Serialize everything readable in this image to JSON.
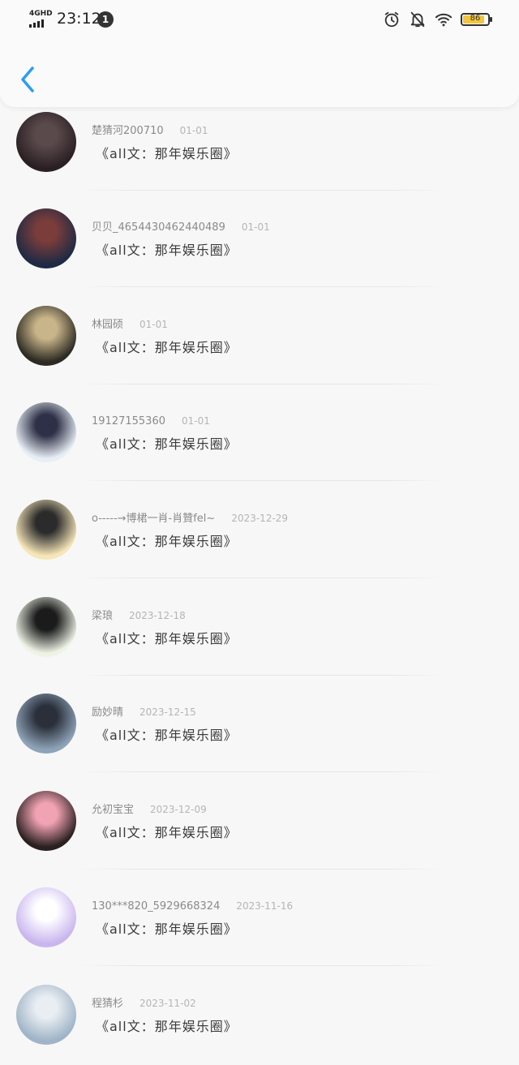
{
  "status_bar": {
    "network": "4GHD",
    "time": "23:12",
    "notification_count": "1",
    "battery": "86",
    "icons": [
      "alarm-icon",
      "bell-muted-icon",
      "wifi-icon",
      "battery-icon"
    ]
  },
  "header": {
    "back_icon": "chevron-left-icon",
    "accent": "#2a9df4"
  },
  "items": [
    {
      "user": "楚猜河200710",
      "date": "01-01",
      "content": "《all文：那年娱乐圈》",
      "avatar_colors": [
        "#2a2024",
        "#5b4a4c"
      ]
    },
    {
      "user": "贝贝_4654430462440489",
      "date": "01-01",
      "content": "《all文：那年娱乐圈》",
      "avatar_colors": [
        "#1f2a44",
        "#7a3d3a"
      ]
    },
    {
      "user": "林园硕",
      "date": "01-01",
      "content": "《all文：那年娱乐圈》",
      "avatar_colors": [
        "#2c2a22",
        "#c9b58a"
      ]
    },
    {
      "user": "19127155360",
      "date": "01-01",
      "content": "《all文：那年娱乐圈》",
      "avatar_colors": [
        "#e8eef5",
        "#2d3046"
      ]
    },
    {
      "user": "o-----→博桾一肖-肖贊fel~",
      "date": "2023-12-29",
      "content": "《all文：那年娱乐圈》",
      "avatar_colors": [
        "#f6e6b8",
        "#2b2b2b"
      ]
    },
    {
      "user": "梁琅",
      "date": "2023-12-18",
      "content": "《all文：那年娱乐圈》",
      "avatar_colors": [
        "#eef3e6",
        "#1b1b1b"
      ]
    },
    {
      "user": "励妙晴",
      "date": "2023-12-15",
      "content": "《all文：那年娱乐圈》",
      "avatar_colors": [
        "#8ea3b8",
        "#2a2f3a"
      ]
    },
    {
      "user": "允初宝宝",
      "date": "2023-12-09",
      "content": "《all文：那年娱乐圈》",
      "avatar_colors": [
        "#2a2020",
        "#f2a3b3"
      ]
    },
    {
      "user": "130***820_5929668324",
      "date": "2023-11-16",
      "content": "《all文：那年娱乐圈》",
      "avatar_colors": [
        "#c9b6ee",
        "#ffffff"
      ]
    },
    {
      "user": "程猜杉",
      "date": "2023-11-02",
      "content": "《all文：那年娱乐圈》",
      "avatar_colors": [
        "#9fb4c7",
        "#e9eef2"
      ]
    }
  ]
}
